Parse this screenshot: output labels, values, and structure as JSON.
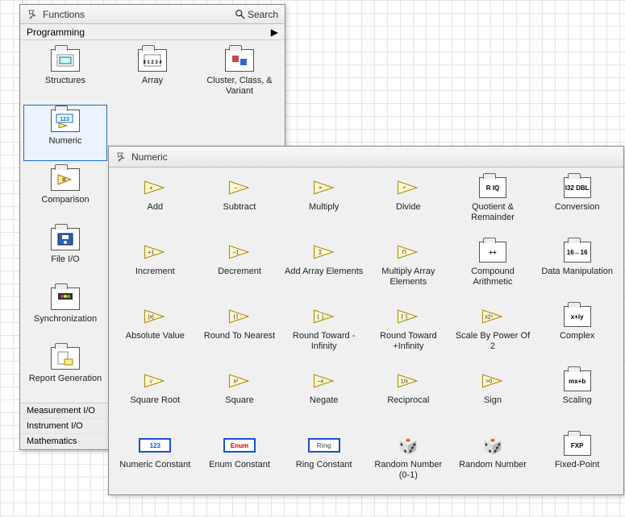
{
  "functions": {
    "title": "Functions",
    "search": "Search",
    "crumb": "Programming",
    "items": [
      {
        "label": "Structures"
      },
      {
        "label": "Array"
      },
      {
        "label": "Cluster, Class, & Variant"
      },
      {
        "label": "Numeric",
        "selected": true
      },
      {
        "label": ""
      },
      {
        "label": ""
      },
      {
        "label": "Comparison"
      },
      {
        "label": ""
      },
      {
        "label": ""
      },
      {
        "label": "File I/O"
      },
      {
        "label": ""
      },
      {
        "label": ""
      },
      {
        "label": "Synchronization"
      },
      {
        "label": ""
      },
      {
        "label": ""
      },
      {
        "label": "Report Generation"
      }
    ],
    "cats": [
      "Measurement I/O",
      "Instrument I/O",
      "Mathematics"
    ]
  },
  "numeric": {
    "title": "Numeric",
    "items": [
      {
        "label": "Add",
        "sym": "+"
      },
      {
        "label": "Subtract",
        "sym": "−"
      },
      {
        "label": "Multiply",
        "sym": "×"
      },
      {
        "label": "Divide",
        "sym": "÷"
      },
      {
        "label": "Quotient & Remainder",
        "sym": "R IQ"
      },
      {
        "label": "Conversion",
        "sym": "I32 DBL"
      },
      {
        "label": "Increment",
        "sym": "+1"
      },
      {
        "label": "Decrement",
        "sym": "−1"
      },
      {
        "label": "Add Array Elements",
        "sym": "Σ"
      },
      {
        "label": "Multiply Array Elements",
        "sym": "Π"
      },
      {
        "label": "Compound Arithmetic",
        "sym": "++"
      },
      {
        "label": "Data Manipulation",
        "sym": "16↔16"
      },
      {
        "label": "Absolute Value",
        "sym": "|x|"
      },
      {
        "label": "Round To Nearest",
        "sym": "⌊⌉"
      },
      {
        "label": "Round Toward -Infinity",
        "sym": "⌊ ⌋"
      },
      {
        "label": "Round Toward +Infinity",
        "sym": "⌈ ⌉"
      },
      {
        "label": "Scale By Power Of 2",
        "sym": "x2ⁿ"
      },
      {
        "label": "Complex",
        "sym": "x+iy"
      },
      {
        "label": "Square Root",
        "sym": "√"
      },
      {
        "label": "Square",
        "sym": "x²"
      },
      {
        "label": "Negate",
        "sym": "−x"
      },
      {
        "label": "Reciprocal",
        "sym": "1/x"
      },
      {
        "label": "Sign",
        "sym": ">0"
      },
      {
        "label": "Scaling",
        "sym": "mx+b"
      },
      {
        "label": "Numeric Constant",
        "sym": "123"
      },
      {
        "label": "Enum Constant",
        "sym": "Enum"
      },
      {
        "label": "Ring Constant",
        "sym": "Ring"
      },
      {
        "label": "Random Number (0-1)",
        "sym": "🎲"
      },
      {
        "label": "Random Number",
        "sym": "🎲"
      },
      {
        "label": "Fixed-Point",
        "sym": "FXP"
      }
    ]
  }
}
